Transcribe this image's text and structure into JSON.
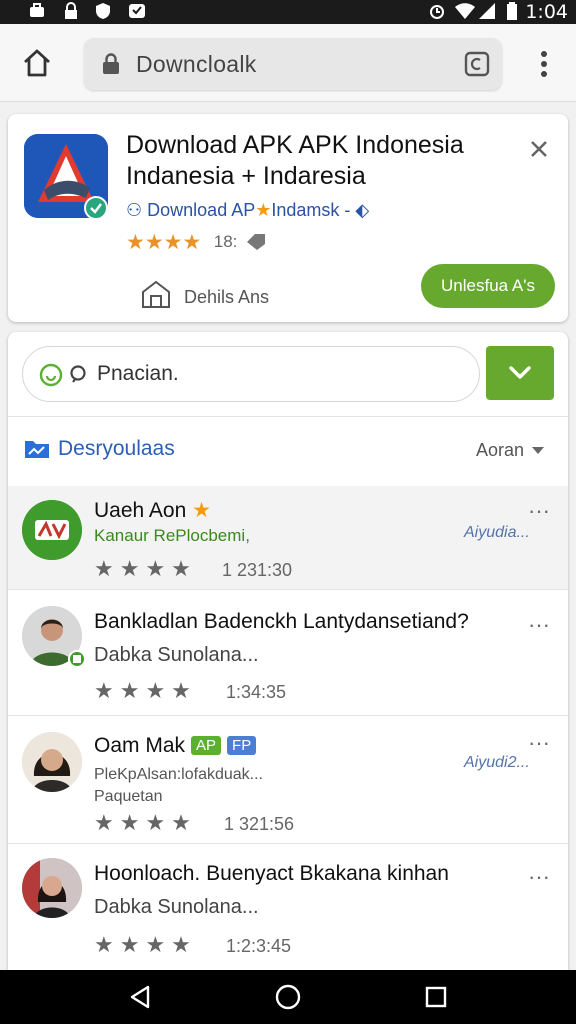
{
  "status_bar": {
    "time": "1:04",
    "icons": [
      "briefcase-icon",
      "lock-icon",
      "shield-icon",
      "notification-icon",
      "alarm-icon",
      "wifi-icon",
      "signal-icon",
      "battery-icon"
    ]
  },
  "browser": {
    "url": "Downcloalk",
    "buttons": [
      "home-icon",
      "lock-icon",
      "tab-icon",
      "more-vert-icon"
    ]
  },
  "app_banner": {
    "title": "Download APK APK Indonesia Indanesia + Indaresia",
    "developer": "Download AP",
    "developer_suffix": "Indamsk - ",
    "rating_stars": "★★★★",
    "rating_count": "18:",
    "details_label": "Dehils Ans",
    "install_label": "Unlesfua A's"
  },
  "search": {
    "placeholder": "Pnacian.",
    "value": "Pnacian."
  },
  "section": {
    "title": "Desryoulaas",
    "sort_label": "Aoran"
  },
  "items": [
    {
      "title": "Uaeh Aon",
      "title_extra": "★",
      "subtitle": "Kanaur RePlocbemi,",
      "stars": "★★★★",
      "time": "1 231:30",
      "reply": "Aiyudia...",
      "more": "···"
    },
    {
      "title": "Bankladlan Badenckh Lantydansetiand?",
      "subtitle": "Dabka Sunolana...",
      "stars": "★★★★",
      "time": "1:34:35",
      "more": "···"
    },
    {
      "title": "Oam Mak",
      "badge1": "AP",
      "badge2": "FP",
      "subtitle": "PleKpAlsan:lofakduak...",
      "subtitle2": "Paquetan",
      "stars": "★★★★",
      "time": "1 321:56",
      "reply": "Aiyudi2...",
      "more": "···"
    },
    {
      "title": "Hoonloach. Buenyact  Bkakana kinhan",
      "subtitle": "Dabka Sunolana...",
      "stars": "★★★★",
      "time": "1:2:3:45",
      "more": "···"
    }
  ],
  "colors": {
    "accent_green": "#67a92f",
    "link_blue": "#2a5fb5",
    "star_orange": "#e8932a"
  }
}
